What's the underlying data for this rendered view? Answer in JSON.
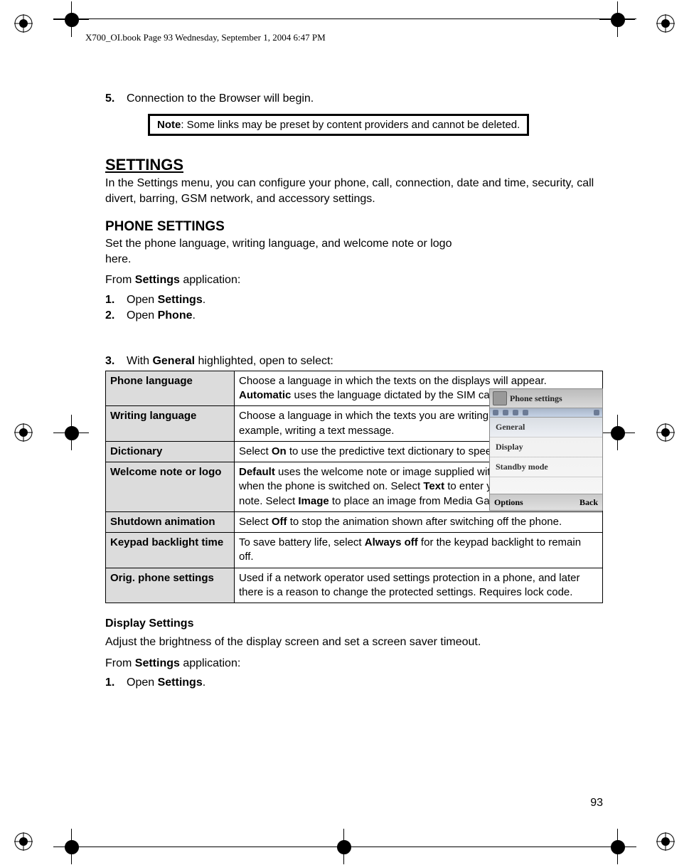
{
  "header_text": "X700_OI.book  Page 93  Wednesday, September 1, 2004  6:47 PM",
  "step5": {
    "num": "5.",
    "text": "Connection to the Browser will begin."
  },
  "note": {
    "label": "Note",
    "text": ":  Some links may be preset by content providers and cannot be deleted."
  },
  "settings_heading": "SETTINGS",
  "settings_intro": "In the Settings menu, you can configure your phone, call, connection, date and time, security, call divert, barring, GSM network, and accessory settings.",
  "phone_settings_heading": "PHONE SETTINGS",
  "phone_settings_intro": "Set the phone language, writing language, and welcome note or logo here.",
  "from_settings_prefix": "From ",
  "from_settings_bold": "Settings",
  "from_settings_suffix": " application:",
  "step1": {
    "num": "1.",
    "prefix": "Open ",
    "bold": "Settings",
    "suffix": "."
  },
  "step2": {
    "num": "2.",
    "prefix": "Open ",
    "bold": "Phone",
    "suffix": "."
  },
  "step3": {
    "num": "3.",
    "prefix": "With ",
    "bold": "General",
    "suffix": " highlighted, open to select:"
  },
  "phone_mock": {
    "title": "Phone settings",
    "items": [
      "General",
      "Display",
      "Standby mode"
    ],
    "softkey_left": "Options",
    "softkey_right": "Back"
  },
  "table_rows": [
    {
      "label": "Phone language",
      "desc": [
        {
          "t": "Choose a language in which the texts on the displays will appear. "
        },
        {
          "b": "Automatic"
        },
        {
          "t": " uses the language dictated by the SIM card."
        }
      ]
    },
    {
      "label": "Writing language",
      "desc": [
        {
          "t": "Choose a language in which the texts you are writing will appear, for example, writing a text message."
        }
      ]
    },
    {
      "label": "Dictionary",
      "desc": [
        {
          "t": "Select "
        },
        {
          "b": "On"
        },
        {
          "t": " to use the predictive text dictionary to speed up text entry."
        }
      ]
    },
    {
      "label": "Welcome note or logo",
      "desc": [
        {
          "b": "Default"
        },
        {
          "t": " uses the welcome note or image supplied with the phone, displayed when the phone is switched on. Select "
        },
        {
          "b": "Text"
        },
        {
          "t": " to enter your own welcome note. Select "
        },
        {
          "b": "Image"
        },
        {
          "t": " to place an image from Media Gallery."
        }
      ]
    },
    {
      "label": "Shutdown animation",
      "desc": [
        {
          "t": "Select "
        },
        {
          "b": "Off"
        },
        {
          "t": " to stop the animation shown after switching off the phone."
        }
      ]
    },
    {
      "label": "Keypad backlight time",
      "desc": [
        {
          "t": "To save battery life, select "
        },
        {
          "b": "Always off"
        },
        {
          "t": " for the keypad backlight to remain off."
        }
      ]
    },
    {
      "label": "Orig. phone settings",
      "desc": [
        {
          "t": "Used if a network operator used settings protection in a phone, and later there is a reason to change the protected settings. Requires lock code."
        }
      ]
    }
  ],
  "display_settings_heading": "Display Settings",
  "display_settings_intro": "Adjust the brightness of the display screen and set a screen saver timeout.",
  "disp_from_prefix": "From ",
  "disp_from_bold": "Settings",
  "disp_from_suffix": " application:",
  "disp_step1": {
    "num": "1.",
    "prefix": "Open ",
    "bold": "Settings",
    "suffix": "."
  },
  "page_number": "93"
}
